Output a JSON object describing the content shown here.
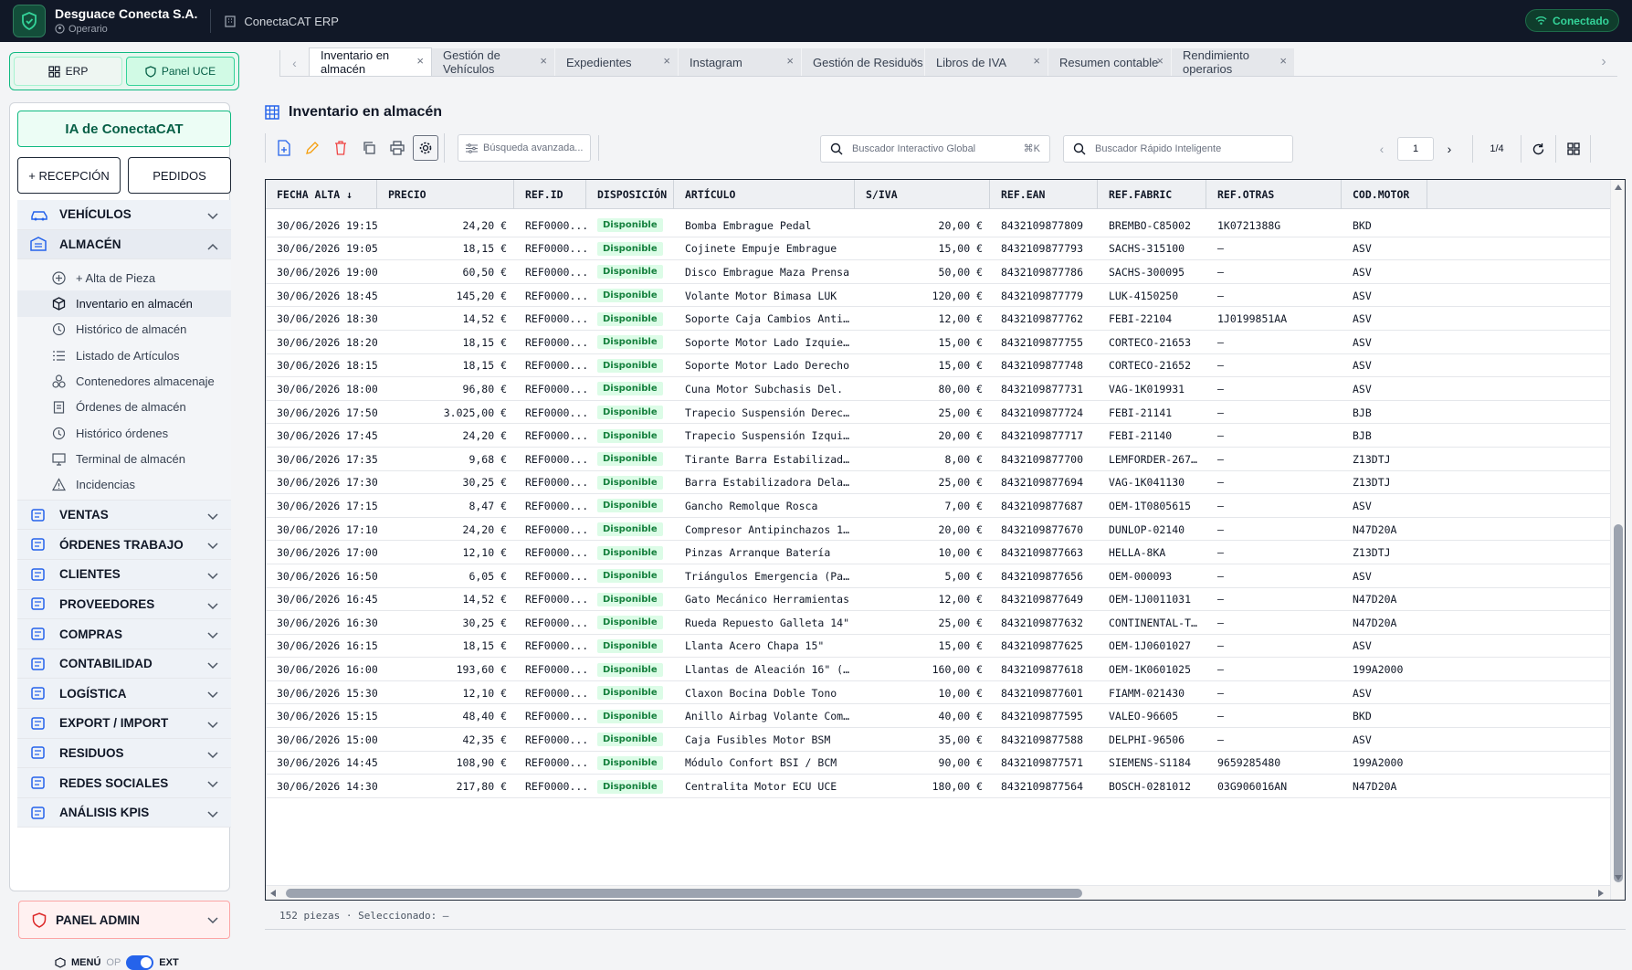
{
  "topbar": {
    "company": "Desguace Conecta S.A.",
    "role": "Operario",
    "erp": "ConectaCAT ERP",
    "status": "Conectado"
  },
  "sidebar": {
    "mode_erp": "ERP",
    "mode_uce": "Panel UCE",
    "ia_button": "IA de ConectaCAT",
    "recepcion": "+ RECEPCIÓN",
    "pedidos": "PEDIDOS",
    "nav_top": [
      {
        "label": "VEHÍCULOS",
        "icon": "car-icon"
      },
      {
        "label": "ALMACÉN",
        "icon": "warehouse-icon"
      }
    ],
    "almacen_items": [
      {
        "label": "+ Alta de Pieza",
        "icon": "plus-circle-icon"
      },
      {
        "label": "Inventario en almacén",
        "icon": "boxes-icon"
      },
      {
        "label": "Histórico de almacén",
        "icon": "history-icon"
      },
      {
        "label": "Listado de Artículos",
        "icon": "list-icon"
      },
      {
        "label": "Contenedores almacenaje",
        "icon": "containers-icon"
      },
      {
        "label": "Órdenes de almacén",
        "icon": "clipboard-icon"
      },
      {
        "label": "Histórico órdenes",
        "icon": "history-icon"
      },
      {
        "label": "Terminal de almacén",
        "icon": "monitor-icon"
      },
      {
        "label": "Incidencias",
        "icon": "warning-icon"
      }
    ],
    "nav_bottom": [
      {
        "label": "VENTAS",
        "icon": "dollar-icon"
      },
      {
        "label": "ÓRDENES TRABAJO",
        "icon": "wrench-icon"
      },
      {
        "label": "CLIENTES",
        "icon": "users-icon"
      },
      {
        "label": "PROVEEDORES",
        "icon": "user-group-icon"
      },
      {
        "label": "COMPRAS",
        "icon": "cart-icon"
      },
      {
        "label": "CONTABILIDAD",
        "icon": "calculator-icon"
      },
      {
        "label": "LOGÍSTICA",
        "icon": "truck-icon"
      },
      {
        "label": "EXPORT / IMPORT",
        "icon": "globe-icon"
      },
      {
        "label": "RESIDUOS",
        "icon": "recycle-icon"
      },
      {
        "label": "REDES SOCIALES",
        "icon": "share-icon"
      },
      {
        "label": "ANÁLISIS KPIS",
        "icon": "bar-chart-icon"
      }
    ],
    "admin": "PANEL ADMIN",
    "menu_label": "MENÚ",
    "menu_op": "OP",
    "menu_ext": "EXT"
  },
  "tabs": [
    {
      "label": "Inventario en almacén",
      "active": true
    },
    {
      "label": "Gestión de Vehículos"
    },
    {
      "label": "Expedientes"
    },
    {
      "label": "Instagram"
    },
    {
      "label": "Gestión de Residuos"
    },
    {
      "label": "Libros de IVA"
    },
    {
      "label": "Resumen contable"
    },
    {
      "label": "Rendimiento operarios"
    }
  ],
  "page": {
    "title": "Inventario en almacén",
    "adv_search_placeholder": "Búsqueda avanzada...",
    "global_search_placeholder": "Buscador Interactivo Global",
    "global_search_kbd": "⌘K",
    "quick_search_placeholder": "Buscador Rápido Inteligente",
    "page_current": "1",
    "page_total": "1/4",
    "footer": "152 piezas · Seleccionado: —"
  },
  "grid": {
    "columns": [
      {
        "key": "fecha",
        "label": "FECHA ALTA ↓",
        "width": 122
      },
      {
        "key": "precio",
        "label": "PRECIO",
        "width": 150,
        "align": "right"
      },
      {
        "key": "refid",
        "label": "REF.ID",
        "width": 79
      },
      {
        "key": "disp",
        "label": "DISPOSICIÓN",
        "width": 96
      },
      {
        "key": "articulo",
        "label": "ARTÍCULO",
        "width": 198
      },
      {
        "key": "siva",
        "label": "S/IVA",
        "width": 148,
        "align": "right"
      },
      {
        "key": "ean",
        "label": "REF.EAN",
        "width": 118
      },
      {
        "key": "fabric",
        "label": "REF.FABRIC",
        "width": 119
      },
      {
        "key": "otras",
        "label": "REF.OTRAS",
        "width": 148
      },
      {
        "key": "motor",
        "label": "COD.MOTOR",
        "width": 94
      }
    ],
    "rows": [
      [
        "30/06/2026 19:15",
        "24,20 €",
        "REF0000...",
        "Disponible",
        "Bomba Embrague Pedal",
        "20,00 €",
        "8432109877809",
        "BREMBO-C85002",
        "1K0721388G",
        "BKD"
      ],
      [
        "30/06/2026 19:05",
        "18,15 €",
        "REF0000...",
        "Disponible",
        "Cojinete Empuje Embrague",
        "15,00 €",
        "8432109877793",
        "SACHS-315100",
        "—",
        "ASV"
      ],
      [
        "30/06/2026 19:00",
        "60,50 €",
        "REF0000...",
        "Disponible",
        "Disco Embrague Maza Prensa",
        "50,00 €",
        "8432109877786",
        "SACHS-300095",
        "—",
        "ASV"
      ],
      [
        "30/06/2026 18:45",
        "145,20 €",
        "REF0000...",
        "Disponible",
        "Volante Motor Bimasa LUK",
        "120,00 €",
        "8432109877779",
        "LUK-4150250",
        "—",
        "ASV"
      ],
      [
        "30/06/2026 18:30",
        "14,52 €",
        "REF0000...",
        "Disponible",
        "Soporte Caja Cambios Anti…",
        "12,00 €",
        "8432109877762",
        "FEBI-22104",
        "1J0199851AA",
        "ASV"
      ],
      [
        "30/06/2026 18:20",
        "18,15 €",
        "REF0000...",
        "Disponible",
        "Soporte Motor Lado Izquie…",
        "15,00 €",
        "8432109877755",
        "CORTECO-21653",
        "—",
        "ASV"
      ],
      [
        "30/06/2026 18:15",
        "18,15 €",
        "REF0000...",
        "Disponible",
        "Soporte Motor Lado Derecho",
        "15,00 €",
        "8432109877748",
        "CORTECO-21652",
        "—",
        "ASV"
      ],
      [
        "30/06/2026 18:00",
        "96,80 €",
        "REF0000...",
        "Disponible",
        "Cuna Motor Subchasis Del.",
        "80,00 €",
        "8432109877731",
        "VAG-1K019931",
        "—",
        "ASV"
      ],
      [
        "30/06/2026 17:50",
        "3.025,00 €",
        "REF0000...",
        "Disponible",
        "Trapecio Suspensión Derec…",
        "25,00 €",
        "8432109877724",
        "FEBI-21141",
        "—",
        "BJB"
      ],
      [
        "30/06/2026 17:45",
        "24,20 €",
        "REF0000...",
        "Disponible",
        "Trapecio Suspensión Izqui…",
        "20,00 €",
        "8432109877717",
        "FEBI-21140",
        "—",
        "BJB"
      ],
      [
        "30/06/2026 17:35",
        "9,68 €",
        "REF0000...",
        "Disponible",
        "Tirante Barra Estabilizad…",
        "8,00 €",
        "8432109877700",
        "LEMFORDER-267…",
        "—",
        "Z13DTJ"
      ],
      [
        "30/06/2026 17:30",
        "30,25 €",
        "REF0000...",
        "Disponible",
        "Barra Estabilizadora Dela…",
        "25,00 €",
        "8432109877694",
        "VAG-1K041130",
        "—",
        "Z13DTJ"
      ],
      [
        "30/06/2026 17:15",
        "8,47 €",
        "REF0000...",
        "Disponible",
        "Gancho Remolque Rosca",
        "7,00 €",
        "8432109877687",
        "OEM-1T0805615",
        "—",
        "ASV"
      ],
      [
        "30/06/2026 17:10",
        "24,20 €",
        "REF0000...",
        "Disponible",
        "Compresor Antipinchazos 1…",
        "20,00 €",
        "8432109877670",
        "DUNLOP-02140",
        "—",
        "N47D20A"
      ],
      [
        "30/06/2026 17:00",
        "12,10 €",
        "REF0000...",
        "Disponible",
        "Pinzas Arranque Batería",
        "10,00 €",
        "8432109877663",
        "HELLA-8KA",
        "—",
        "Z13DTJ"
      ],
      [
        "30/06/2026 16:50",
        "6,05 €",
        "REF0000...",
        "Disponible",
        "Triángulos Emergencia (Pa…",
        "5,00 €",
        "8432109877656",
        "OEM-000093",
        "—",
        "ASV"
      ],
      [
        "30/06/2026 16:45",
        "14,52 €",
        "REF0000...",
        "Disponible",
        "Gato Mecánico Herramientas",
        "12,00 €",
        "8432109877649",
        "OEM-1J0011031",
        "—",
        "N47D20A"
      ],
      [
        "30/06/2026 16:30",
        "30,25 €",
        "REF0000...",
        "Disponible",
        "Rueda Repuesto Galleta 14\"",
        "25,00 €",
        "8432109877632",
        "CONTINENTAL-T…",
        "—",
        "N47D20A"
      ],
      [
        "30/06/2026 16:15",
        "18,15 €",
        "REF0000...",
        "Disponible",
        "Llanta Acero Chapa 15\"",
        "15,00 €",
        "8432109877625",
        "OEM-1J0601027",
        "—",
        "ASV"
      ],
      [
        "30/06/2026 16:00",
        "193,60 €",
        "REF0000...",
        "Disponible",
        "Llantas de Aleación 16\" (…",
        "160,00 €",
        "8432109877618",
        "OEM-1K0601025",
        "—",
        "199A2000"
      ],
      [
        "30/06/2026 15:30",
        "12,10 €",
        "REF0000...",
        "Disponible",
        "Claxon Bocina Doble Tono",
        "10,00 €",
        "8432109877601",
        "FIAMM-021430",
        "—",
        "ASV"
      ],
      [
        "30/06/2026 15:15",
        "48,40 €",
        "REF0000...",
        "Disponible",
        "Anillo Airbag Volante Com…",
        "40,00 €",
        "8432109877595",
        "VALEO-96605",
        "—",
        "BKD"
      ],
      [
        "30/06/2026 15:00",
        "42,35 €",
        "REF0000...",
        "Disponible",
        "Caja Fusibles Motor BSM",
        "35,00 €",
        "8432109877588",
        "DELPHI-96506",
        "—",
        "ASV"
      ],
      [
        "30/06/2026 14:45",
        "108,90 €",
        "REF0000...",
        "Disponible",
        "Módulo Confort BSI / BCM",
        "90,00 €",
        "8432109877571",
        "SIEMENS-S1184",
        "9659285480",
        "199A2000"
      ],
      [
        "30/06/2026 14:30",
        "217,80 €",
        "REF0000...",
        "Disponible",
        "Centralita Motor ECU UCE",
        "180,00 €",
        "8432109877564",
        "BOSCH-0281012",
        "03G906016AN",
        "N47D20A"
      ]
    ]
  },
  "colors": {
    "topbar": "#111827",
    "accent": "#10b981",
    "status_green": "#15803d",
    "badge_bg": "#dcfce7"
  }
}
